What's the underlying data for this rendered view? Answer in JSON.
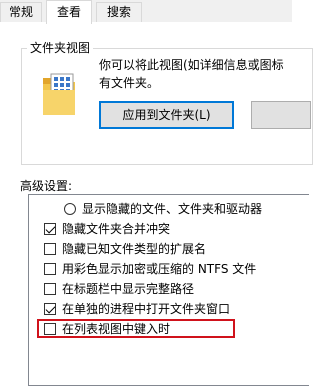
{
  "tabs": [
    {
      "label": "常规",
      "active": false
    },
    {
      "label": "查看",
      "active": true
    },
    {
      "label": "搜索",
      "active": false
    }
  ],
  "folder_views": {
    "title": "文件夹视图",
    "description_line1": "你可以将此视图(如详细信息或图标",
    "description_line2": "有文件夹。",
    "apply_button": "应用到文件夹(L)",
    "second_button": ""
  },
  "advanced": {
    "label": "高级设置:",
    "items": [
      {
        "type": "radio",
        "label": "显示隐藏的文件、文件夹和驱动器",
        "checked": false
      },
      {
        "type": "checkbox",
        "label": "隐藏文件夹合并冲突",
        "checked": true
      },
      {
        "type": "checkbox",
        "label": "隐藏已知文件类型的扩展名",
        "checked": false
      },
      {
        "type": "checkbox",
        "label": "用彩色显示加密或压缩的 NTFS 文件",
        "checked": false
      },
      {
        "type": "checkbox",
        "label": "在标题栏中显示完整路径",
        "checked": false
      },
      {
        "type": "checkbox",
        "label": "在单独的进程中打开文件夹窗口",
        "checked": true
      },
      {
        "type": "checkbox",
        "label": "在列表视图中键入时",
        "checked": false
      }
    ]
  },
  "colors": {
    "accent": "#0078d7",
    "highlight": "#d0121b"
  }
}
